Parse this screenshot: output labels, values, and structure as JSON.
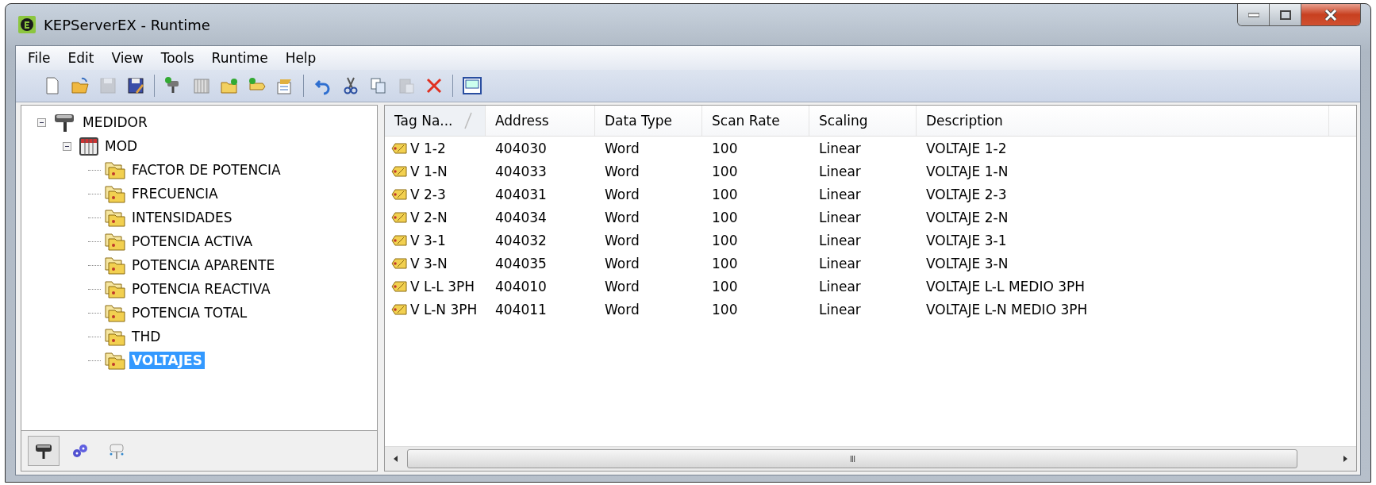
{
  "window": {
    "title": "KEPServerEX - Runtime"
  },
  "menu": [
    "File",
    "Edit",
    "View",
    "Tools",
    "Runtime",
    "Help"
  ],
  "toolbar": [
    {
      "kind": "new",
      "disabled": false
    },
    {
      "kind": "open",
      "disabled": false
    },
    {
      "kind": "save",
      "disabled": true
    },
    {
      "kind": "saveas",
      "disabled": false
    },
    {
      "kind": "sep"
    },
    {
      "kind": "channel",
      "disabled": false
    },
    {
      "kind": "device",
      "disabled": false
    },
    {
      "kind": "group",
      "disabled": false
    },
    {
      "kind": "tag",
      "disabled": false
    },
    {
      "kind": "props",
      "disabled": false
    },
    {
      "kind": "sep"
    },
    {
      "kind": "undo",
      "disabled": false
    },
    {
      "kind": "cut",
      "disabled": false
    },
    {
      "kind": "copy",
      "disabled": false
    },
    {
      "kind": "paste",
      "disabled": true
    },
    {
      "kind": "delete",
      "disabled": false
    },
    {
      "kind": "sep"
    },
    {
      "kind": "qc",
      "disabled": false
    }
  ],
  "tree": [
    {
      "label": "MEDIDOR",
      "kind": "channel",
      "expanded": true,
      "selected": false,
      "children": [
        {
          "label": "MOD",
          "kind": "device",
          "expanded": true,
          "selected": false,
          "children": [
            {
              "label": "FACTOR DE POTENCIA",
              "kind": "group",
              "selected": false
            },
            {
              "label": "FRECUENCIA",
              "kind": "group",
              "selected": false
            },
            {
              "label": "INTENSIDADES",
              "kind": "group",
              "selected": false
            },
            {
              "label": "POTENCIA ACTIVA",
              "kind": "group",
              "selected": false
            },
            {
              "label": "POTENCIA APARENTE",
              "kind": "group",
              "selected": false
            },
            {
              "label": "POTENCIA REACTIVA",
              "kind": "group",
              "selected": false
            },
            {
              "label": "POTENCIA TOTAL",
              "kind": "group",
              "selected": false
            },
            {
              "label": "THD",
              "kind": "group",
              "selected": false
            },
            {
              "label": "VOLTAJES",
              "kind": "group",
              "selected": true
            }
          ]
        }
      ]
    }
  ],
  "pane_tabs": [
    {
      "kind": "channel",
      "selected": true
    },
    {
      "kind": "gears",
      "selected": false
    },
    {
      "kind": "alias",
      "selected": false
    }
  ],
  "table": {
    "columns": [
      {
        "label": "Tag Na...",
        "sorted": true
      },
      {
        "label": "Address",
        "sorted": false
      },
      {
        "label": "Data Type",
        "sorted": false
      },
      {
        "label": "Scan Rate",
        "sorted": false
      },
      {
        "label": "Scaling",
        "sorted": false
      },
      {
        "label": "Description",
        "sorted": false
      }
    ],
    "rows": [
      [
        "V 1-2",
        "404030",
        "Word",
        "100",
        "Linear",
        "VOLTAJE 1-2"
      ],
      [
        "V 1-N",
        "404033",
        "Word",
        "100",
        "Linear",
        "VOLTAJE 1-N"
      ],
      [
        "V 2-3",
        "404031",
        "Word",
        "100",
        "Linear",
        "VOLTAJE 2-3"
      ],
      [
        "V 2-N",
        "404034",
        "Word",
        "100",
        "Linear",
        "VOLTAJE 2-N"
      ],
      [
        "V 3-1",
        "404032",
        "Word",
        "100",
        "Linear",
        "VOLTAJE 3-1"
      ],
      [
        "V 3-N",
        "404035",
        "Word",
        "100",
        "Linear",
        "VOLTAJE 3-N"
      ],
      [
        "V L-L 3PH",
        "404010",
        "Word",
        "100",
        "Linear",
        "VOLTAJE L-L MEDIO 3PH"
      ],
      [
        "V L-N 3PH",
        "404011",
        "Word",
        "100",
        "Linear",
        "VOLTAJE L-N MEDIO 3PH"
      ]
    ]
  },
  "scrollbar": {
    "grip": "III"
  }
}
